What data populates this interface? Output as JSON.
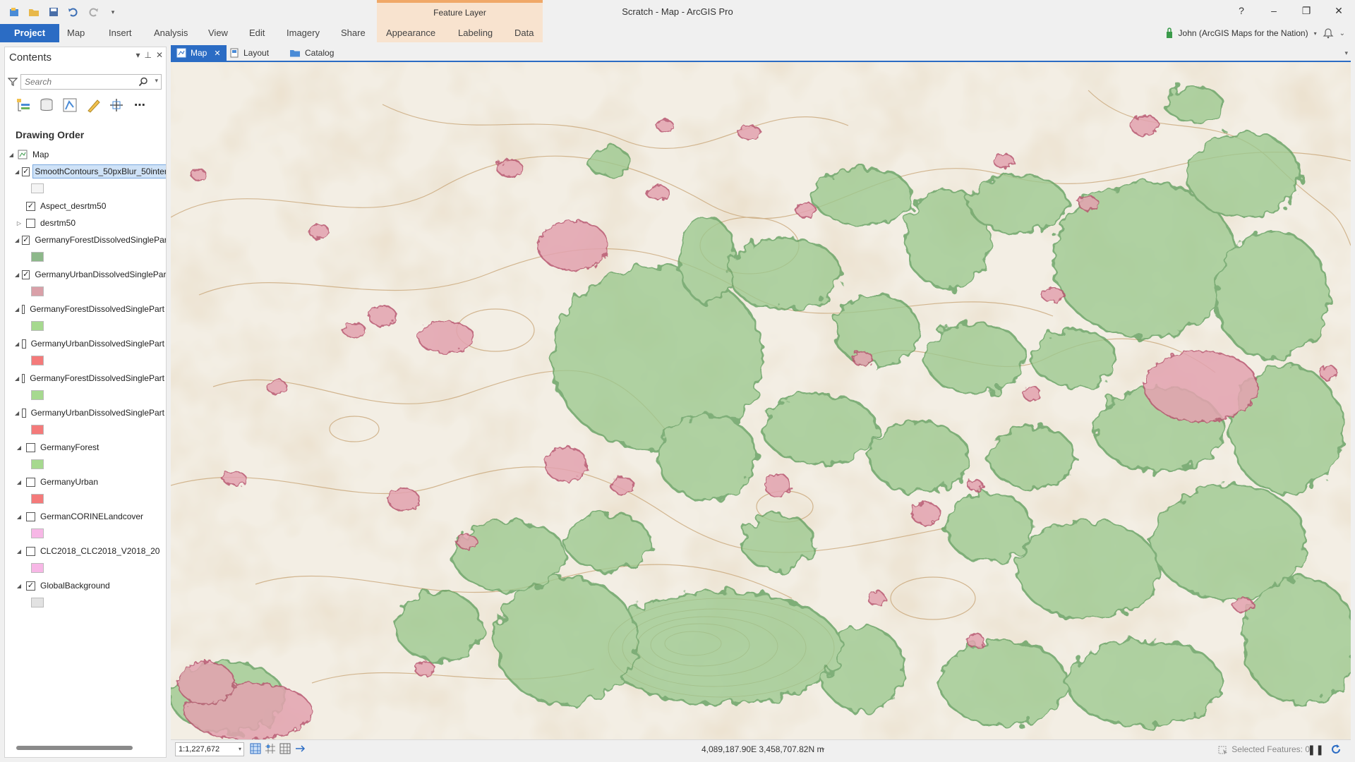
{
  "app": {
    "title": "Scratch - Map - ArcGIS Pro",
    "contextual_header": "Feature Layer"
  },
  "window_controls": {
    "help": "?",
    "minimize": "–",
    "restore": "❐",
    "close": "✕"
  },
  "ribbon": {
    "tabs": [
      "Project",
      "Map",
      "Insert",
      "Analysis",
      "View",
      "Edit",
      "Imagery",
      "Share",
      "Appearance",
      "Labeling",
      "Data"
    ],
    "user": "John (ArcGIS Maps for the Nation)"
  },
  "contents": {
    "title": "Contents",
    "search_placeholder": "Search",
    "section_title": "Drawing Order",
    "map_name": "Map",
    "layers": [
      {
        "name": "SmoothContours_50pxBlur_50inter",
        "checked": true,
        "expanded": true,
        "selected": true,
        "swatch": "#f4f4f4"
      },
      {
        "name": "Aspect_desrtm50",
        "checked": true,
        "expanded": null,
        "swatch": null
      },
      {
        "name": "desrtm50",
        "checked": false,
        "expanded": false,
        "swatch": null
      },
      {
        "name": "GermanyForestDissolvedSinglePart",
        "checked": true,
        "expanded": true,
        "swatch": "#8db88a"
      },
      {
        "name": "GermanyUrbanDissolvedSinglePart",
        "checked": true,
        "expanded": true,
        "swatch": "#d9a0a8"
      },
      {
        "name": "GermanyForestDissolvedSinglePart",
        "checked": false,
        "expanded": true,
        "swatch": "#a6d98f"
      },
      {
        "name": "GermanyUrbanDissolvedSinglePart",
        "checked": false,
        "expanded": true,
        "swatch": "#f47a7a"
      },
      {
        "name": "GermanyForestDissolvedSinglePart",
        "checked": false,
        "expanded": true,
        "swatch": "#a6d98f"
      },
      {
        "name": "GermanyUrbanDissolvedSinglePart",
        "checked": false,
        "expanded": true,
        "swatch": "#f47a7a"
      },
      {
        "name": "GermanyForest",
        "checked": false,
        "expanded": true,
        "swatch": "#a6d98f"
      },
      {
        "name": "GermanyUrban",
        "checked": false,
        "expanded": true,
        "swatch": "#f47a7a"
      },
      {
        "name": "GermanCORINELandcover",
        "checked": false,
        "expanded": true,
        "swatch": "#f7b7e6"
      },
      {
        "name": "CLC2018_CLC2018_V2018_20",
        "checked": false,
        "expanded": true,
        "swatch": "#f7b7e6"
      },
      {
        "name": "GlobalBackground",
        "checked": true,
        "expanded": true,
        "swatch": "#e2e2e2"
      }
    ]
  },
  "doc_tabs": [
    {
      "label": "Map",
      "active": true,
      "closable": true
    },
    {
      "label": "Layout",
      "active": false
    },
    {
      "label": "Catalog",
      "active": false
    }
  ],
  "map": {
    "colors": {
      "paper": "#f2ece0",
      "forest": "#9cc98f",
      "forest_edge": "#5f9e5c",
      "urban": "#e3a3b0",
      "urban_edge": "#b8566f",
      "contour": "#c7a374"
    }
  },
  "status": {
    "scale": "1:1,227,672",
    "coordinates": "4,089,187.90E 3,458,707.82N m",
    "selected_features": "Selected Features: 0"
  }
}
